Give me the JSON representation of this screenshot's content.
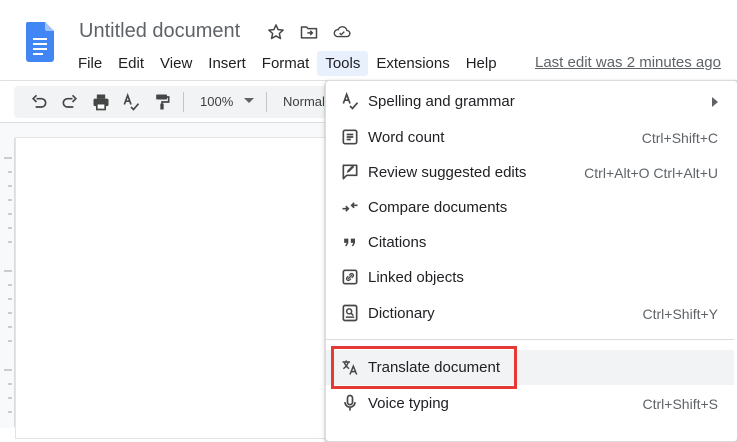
{
  "header": {
    "doc_title": "Untitled document",
    "last_edit": "Last edit was 2 minutes ago",
    "icons": [
      "docs-logo-icon",
      "star-icon",
      "move-to-folder-icon",
      "cloud-status-icon"
    ]
  },
  "menubar": {
    "items": [
      "File",
      "Edit",
      "View",
      "Insert",
      "Format",
      "Tools",
      "Extensions",
      "Help"
    ],
    "active": "Tools"
  },
  "toolbar": {
    "zoom": "100%",
    "style": "Normal",
    "icons": [
      "undo-icon",
      "redo-icon",
      "print-icon",
      "spellcheck-icon",
      "paint-format-icon"
    ]
  },
  "tools_menu": {
    "items": [
      {
        "label": "Spelling and grammar",
        "shortcut": "",
        "icon": "spellcheck-icon",
        "submenu": true
      },
      {
        "label": "Word count",
        "shortcut": "Ctrl+Shift+C",
        "icon": "word-count-icon"
      },
      {
        "label": "Review suggested edits",
        "shortcut": "Ctrl+Alt+O Ctrl+Alt+U",
        "icon": "review-edits-icon"
      },
      {
        "label": "Compare documents",
        "shortcut": "",
        "icon": "compare-icon"
      },
      {
        "label": "Citations",
        "shortcut": "",
        "icon": "quote-icon"
      },
      {
        "label": "Linked objects",
        "shortcut": "",
        "icon": "link-icon"
      },
      {
        "label": "Dictionary",
        "shortcut": "Ctrl+Shift+Y",
        "icon": "dictionary-icon"
      },
      {
        "label": "Translate document",
        "shortcut": "",
        "icon": "translate-icon",
        "highlighted": true
      },
      {
        "label": "Voice typing",
        "shortcut": "Ctrl+Shift+S",
        "icon": "microphone-icon"
      }
    ]
  },
  "colors": {
    "docs_blue": "#4285f4",
    "active_menu_bg": "#e8f0fe",
    "highlight_border": "#e53935",
    "hover_bg": "#f1f3f4"
  }
}
